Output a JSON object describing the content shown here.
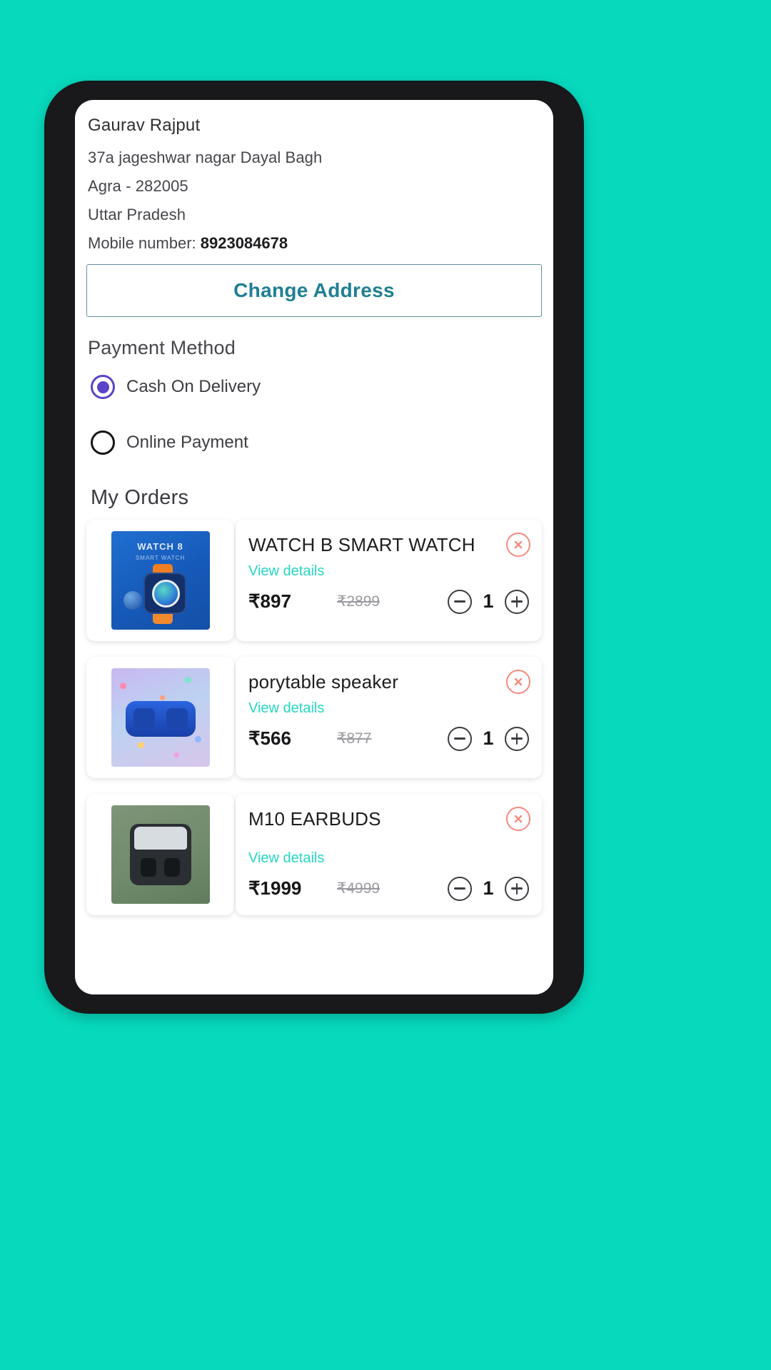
{
  "theme": {
    "background": "#07d9bd",
    "phone_frame": "#19181a",
    "accent_teal": "#25d6c4",
    "link_blue": "#1f7f95",
    "radio_selected": "#5b43c9",
    "remove_red": "#f58a7d"
  },
  "address": {
    "name": "Gaurav Rajput",
    "street": "37a jageshwar nagar Dayal Bagh",
    "city_pin": "Agra -  282005",
    "state": "Uttar Pradesh",
    "mobile_label": "Mobile number: ",
    "mobile_value": "8923084678",
    "change_button": "Change Address"
  },
  "payment": {
    "title": "Payment Method",
    "options": [
      {
        "label": "Cash On Delivery",
        "selected": true
      },
      {
        "label": "Online Payment",
        "selected": false
      }
    ]
  },
  "orders": {
    "title": "My Orders",
    "view_details_label": "View details",
    "items": [
      {
        "name": "WATCH B SMART WATCH",
        "price": "₹897",
        "old_price": "₹2899",
        "quantity": "1",
        "thumb": "smartwatch-image",
        "remove_icon": "remove-circle-icon",
        "minus_icon": "minus-circle-icon",
        "plus_icon": "plus-circle-icon"
      },
      {
        "name": "porytable speaker",
        "price": "₹566",
        "old_price": "₹877",
        "quantity": "1",
        "thumb": "portable-speaker-image",
        "remove_icon": "remove-circle-icon",
        "minus_icon": "minus-circle-icon",
        "plus_icon": "plus-circle-icon"
      },
      {
        "name": "M10 EARBUDS",
        "price": "₹1999",
        "old_price": "₹4999",
        "quantity": "1",
        "thumb": "earbuds-image",
        "remove_icon": "remove-circle-icon",
        "minus_icon": "minus-circle-icon",
        "plus_icon": "plus-circle-icon"
      }
    ]
  }
}
